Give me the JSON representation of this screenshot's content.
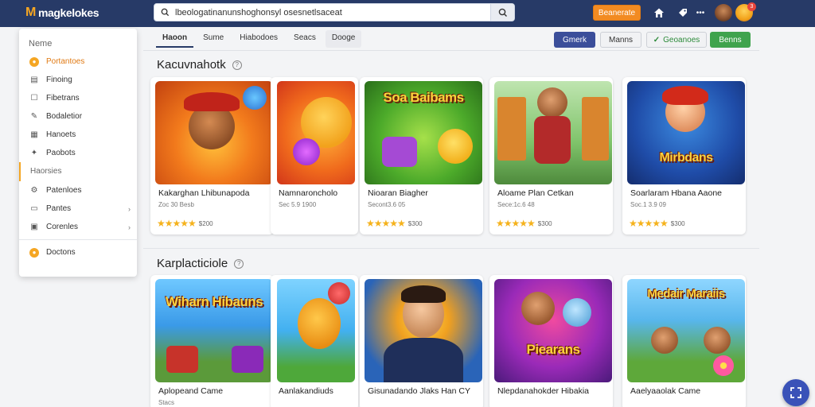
{
  "header": {
    "logo_text": "magkelokes",
    "search_value": "lbeologatinanunshoghonsyl osesnetlsaceat",
    "cta_label": "Beanerate",
    "notification_count": "3"
  },
  "sidebar": {
    "heading": "Neme",
    "items": [
      {
        "label": "Portantoes",
        "icon": "controller-icon"
      },
      {
        "label": "Finoing",
        "icon": "list-icon"
      },
      {
        "label": "Fibetrans",
        "icon": "square-icon"
      },
      {
        "label": "Bodaletior",
        "icon": "tag-icon"
      },
      {
        "label": "Hanoets",
        "icon": "grid-icon"
      },
      {
        "label": "Paobots",
        "icon": "puzzle-icon"
      }
    ],
    "section_label": "Haorsies",
    "sub_items": [
      {
        "label": "Patenloes",
        "icon": "gear-icon"
      },
      {
        "label": "Pantes",
        "icon": "book-icon"
      },
      {
        "label": "Corenles",
        "icon": "image-icon"
      }
    ],
    "footer_label": "Doctons"
  },
  "tabs": [
    "Haoon",
    "Sume",
    "Hiabodoes",
    "Seacs",
    "Dooge"
  ],
  "actions": {
    "btn1": "Gmerk",
    "btn2": "Manns",
    "btn3": "Geoanoes",
    "btn4": "Benns"
  },
  "sections": [
    {
      "title": "Kacuvnahotk",
      "cards": [
        {
          "title": "Kakarghan Lhibunapoda",
          "meta": "Zoc 30 Besb",
          "price": "$200",
          "banner": ""
        },
        {
          "title": "Namnaroncholo",
          "meta": "Sec 5.9 1900",
          "price": "",
          "banner": ""
        },
        {
          "title": "Nioaran Biagher",
          "meta": "Secont3.6 05",
          "price": "$300",
          "banner": "Soa Baibams"
        },
        {
          "title": "Aloame Plan Cetkan",
          "meta": "Sece:1c.6 48",
          "price": "$300",
          "banner": ""
        },
        {
          "title": "Soarlaram Hbana Aaone",
          "meta": "Soc.1 3.9 09",
          "price": "$300",
          "banner": "Mirbdans"
        }
      ]
    },
    {
      "title": "Karplacticiole",
      "cards": [
        {
          "title": "Aplopeand Came",
          "meta": "Stacs",
          "price": "",
          "banner": "Wiharn Hibauns"
        },
        {
          "title": "Aanlakandiuds",
          "meta": "",
          "price": "",
          "banner": ""
        },
        {
          "title": "Gisunadando Jlaks Han CY",
          "meta": "",
          "price": "",
          "banner": ""
        },
        {
          "title": "Nlepdanahokder Hibakia",
          "meta": "",
          "price": "",
          "banner": "Piearans"
        },
        {
          "title": "Aaelyaaolak Came",
          "meta": "",
          "price": "",
          "banner": "Medair Maraiis"
        }
      ]
    }
  ],
  "colors": {
    "header_bg": "#273a67",
    "accent_orange": "#f28b22",
    "star": "#f5b21c",
    "primary_blue": "#3b4e9a",
    "success_green": "#3fa34d"
  }
}
